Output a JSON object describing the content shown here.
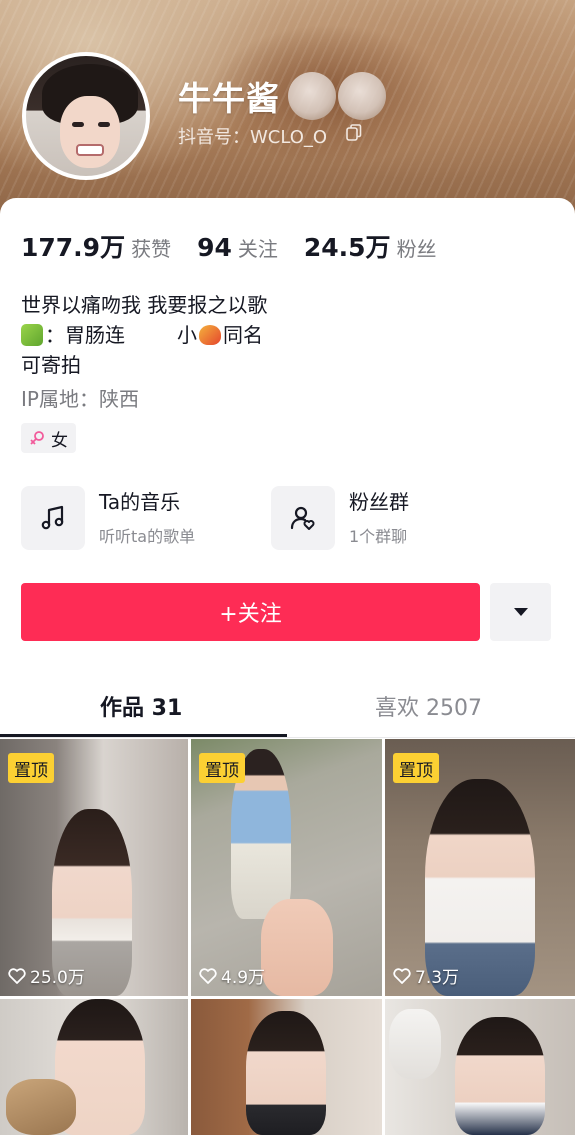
{
  "profile": {
    "username": "牛牛酱",
    "douyin_id": "抖音号：WCLO_O"
  },
  "stats": [
    {
      "num": "177.9万",
      "label": "获赞"
    },
    {
      "num": "94",
      "label": "关注"
    },
    {
      "num": "24.5万",
      "label": "粉丝"
    }
  ],
  "bio": {
    "line1": "世界以痛吻我 我要报之以歌",
    "line2_a": "：胃肠连",
    "line2_b": "小",
    "line2_c": "同名",
    "line3": "可寄拍",
    "ip": "IP属地：陕西",
    "gender": "女"
  },
  "features": {
    "music": {
      "title": "Ta的音乐",
      "sub": "听听ta的歌单"
    },
    "fans_group": {
      "title": "粉丝群",
      "sub": "1个群聊"
    }
  },
  "actions": {
    "follow": "+关注"
  },
  "tabs": [
    {
      "label": "作品 31"
    },
    {
      "label": "喜欢 2507"
    }
  ],
  "videos": [
    {
      "pinned": "置顶",
      "likes": "25.0万"
    },
    {
      "pinned": "置顶",
      "likes": "4.9万"
    },
    {
      "pinned": "置顶",
      "likes": "7.3万"
    },
    {
      "pinned": "",
      "likes": ""
    },
    {
      "pinned": "",
      "likes": ""
    },
    {
      "pinned": "",
      "likes": ""
    }
  ],
  "colors": {
    "accent": "#fe2c55",
    "pin_badge": "#fcd033",
    "text_primary": "#161823",
    "text_secondary": "#7a7b80"
  }
}
